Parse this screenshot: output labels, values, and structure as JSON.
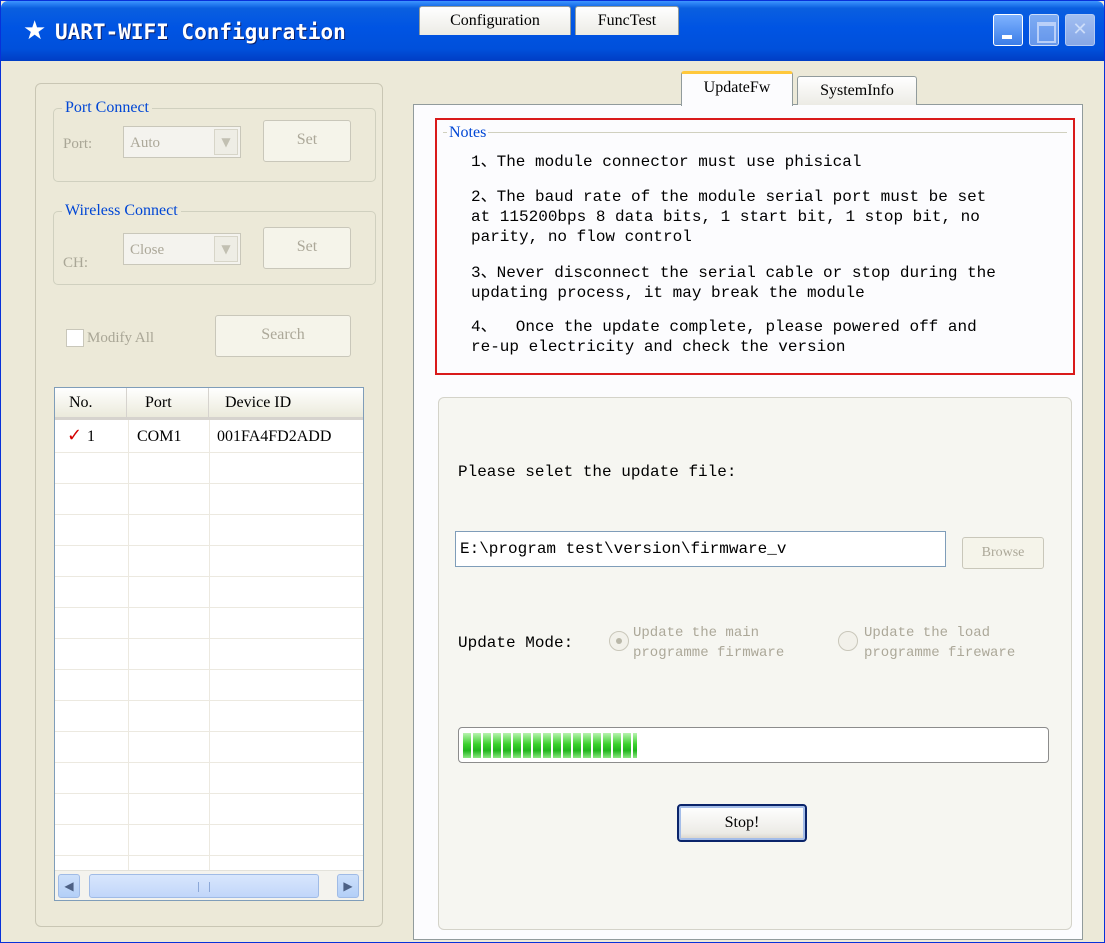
{
  "window": {
    "title": "UART-WIFI Configuration",
    "title_icon": "star-icon"
  },
  "port_connect": {
    "legend": "Port Connect",
    "port_label": "Port:",
    "port_value": "Auto",
    "set_label": "Set"
  },
  "wireless_connect": {
    "legend": "Wireless Connect",
    "ch_label": "CH:",
    "ch_value": "Close",
    "set_label": "Set"
  },
  "modify_all_label": "Modify All",
  "search_label": "Search",
  "device_table": {
    "columns": [
      "No.",
      "Port",
      "Device ID"
    ],
    "rows": [
      {
        "no": "1",
        "port": "COM1",
        "device_id": "001FA4FD2ADD",
        "checked": true
      }
    ]
  },
  "tabs": [
    {
      "label": "Configuration",
      "active": false
    },
    {
      "label": "FuncTest",
      "active": false
    },
    {
      "label": "UpdateFw",
      "active": true
    },
    {
      "label": "SystemInfo",
      "active": false
    }
  ],
  "notes": {
    "legend": "Notes",
    "items": [
      "1、The module connector must use phisical",
      "2、The baud rate of the module serial port must be set\nat 115200bps 8 data bits, 1 start bit, 1 stop bit, no\nparity, no flow control",
      "3、Never disconnect the serial cable or stop during the\nupdating process, it may break the module",
      "4、  Once the update complete, please powered off and\nre-up electricity and check the version"
    ]
  },
  "update": {
    "select_file_label": "Please selet the update file:",
    "file_path": "E:\\program test\\version\\firmware_v",
    "browse_label": "Browse",
    "mode_label": "Update Mode:",
    "mode_main_label": "Update the main\nprogramme firmware",
    "mode_load_label": "Update the load\nprogramme fireware",
    "selected_mode": "main",
    "progress_fraction": 0.3,
    "stop_label": "Stop!"
  }
}
